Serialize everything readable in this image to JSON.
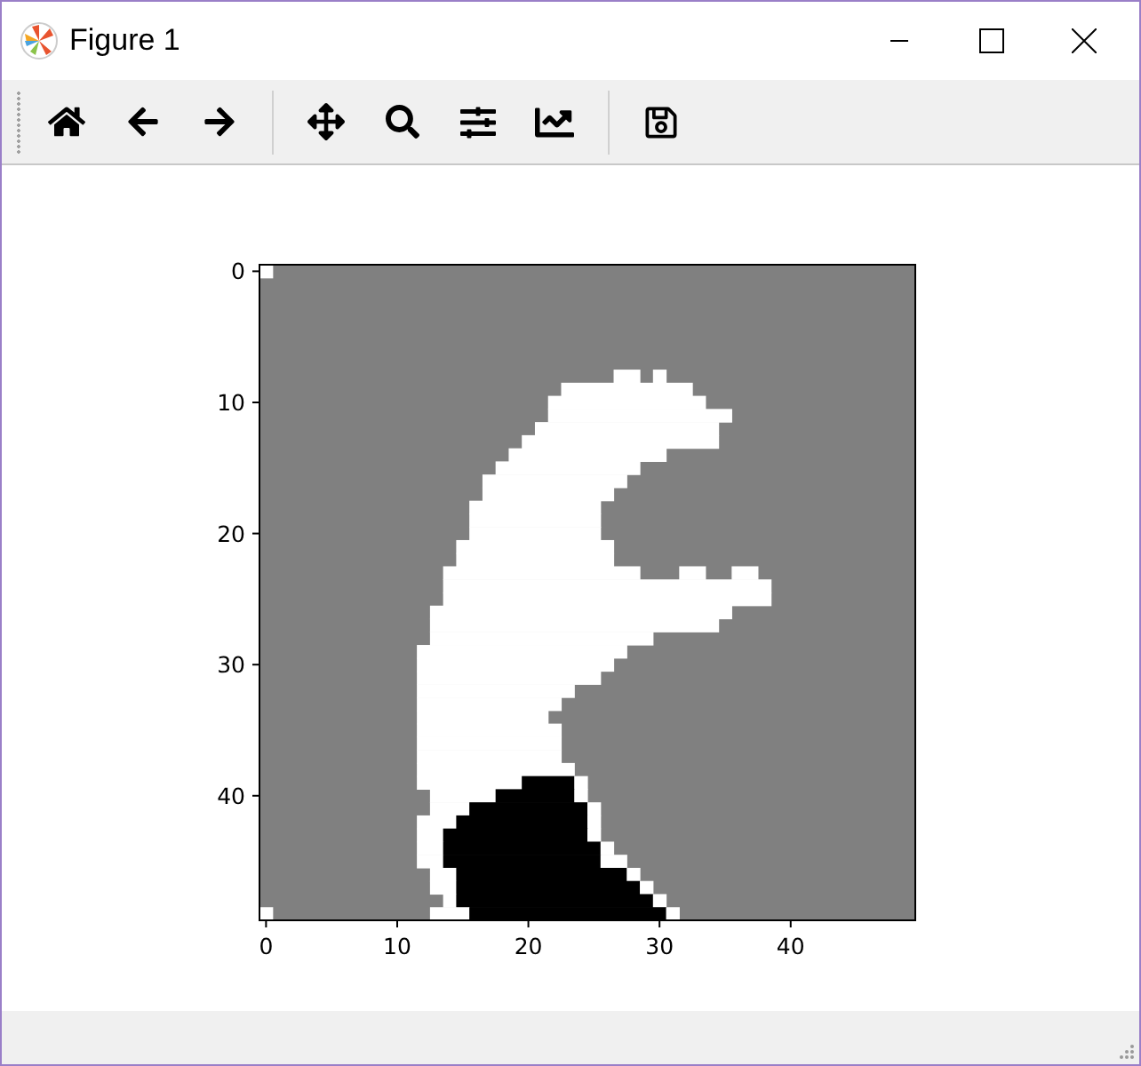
{
  "window": {
    "title": "Figure 1"
  },
  "plot": {
    "xtick_labels": [
      "0",
      "10",
      "20",
      "30",
      "40"
    ],
    "ytick_labels": [
      "0",
      "10",
      "20",
      "30",
      "40"
    ]
  }
}
